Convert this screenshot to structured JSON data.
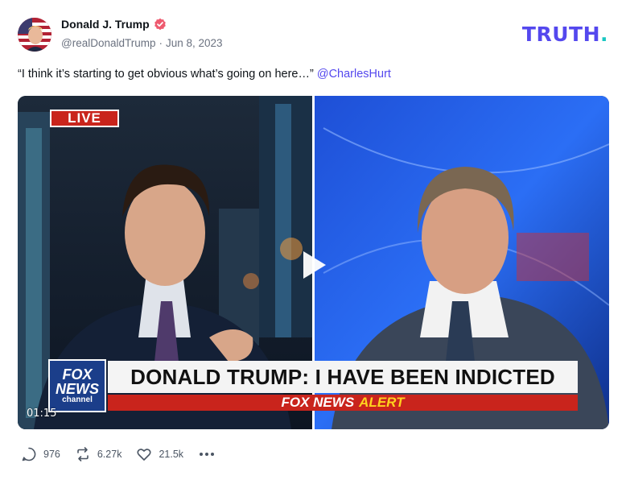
{
  "author": {
    "display_name": "Donald J. Trump",
    "handle": "@realDonaldTrump",
    "separator": "·",
    "date": "Jun 8, 2023"
  },
  "brand": {
    "logo_text": "TRUTH",
    "logo_dot": ".",
    "logo_color": "#5448ee",
    "dot_color": "#19c7c2"
  },
  "post": {
    "text": "“I think it’s starting to get obvious what’s going on here…”",
    "mention": "@CharlesHurt"
  },
  "video": {
    "timestamp": "01:15",
    "live_label": "LIVE",
    "fox_logo_line1": "FOX",
    "fox_logo_line2": "NEWS",
    "fox_logo_line3": "channel",
    "headline": "DONALD TRUMP: I HAVE BEEN INDICTED",
    "alert_prefix": "FOX NEWS",
    "alert_word": "ALERT"
  },
  "actions": {
    "replies": "976",
    "retruths": "6.27k",
    "likes": "21.5k",
    "icons": [
      "reply-icon",
      "retruth-icon",
      "heart-icon",
      "more-icon"
    ]
  }
}
